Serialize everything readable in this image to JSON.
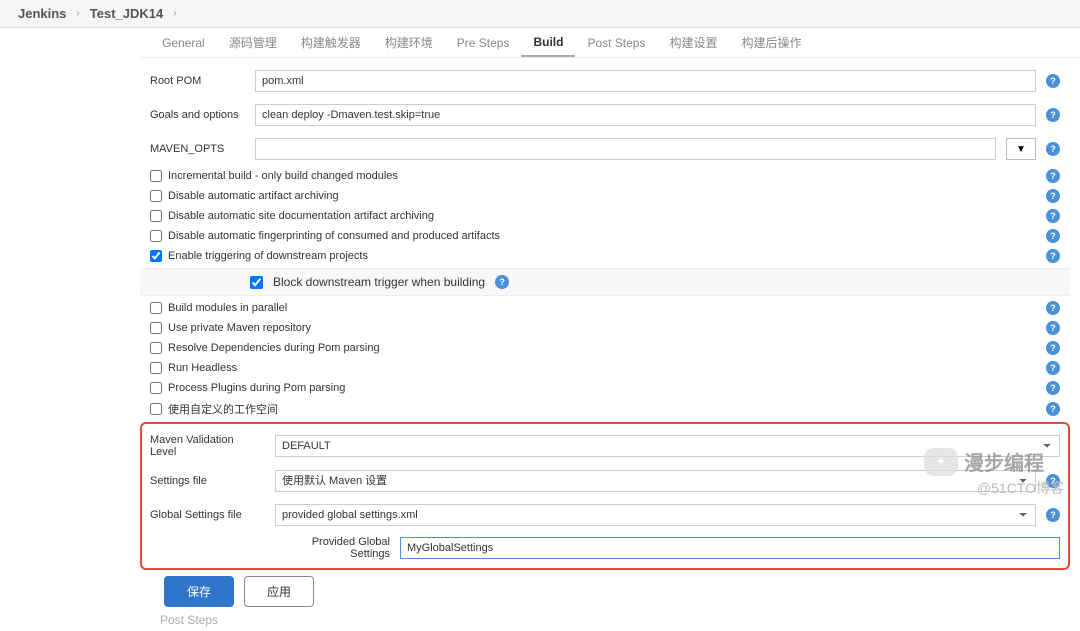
{
  "breadcrumb": {
    "item1": "Jenkins",
    "item2": "Test_JDK14"
  },
  "tabs": {
    "general": "General",
    "src": "源码管理",
    "triggers": "构建触发器",
    "env": "构建环境",
    "pre": "Pre Steps",
    "build": "Build",
    "post": "Post Steps",
    "settings": "构建设置",
    "postactions": "构建后操作"
  },
  "fields": {
    "root_pom_label": "Root POM",
    "root_pom_value": "pom.xml",
    "goals_label": "Goals and options",
    "goals_value": "clean deploy -Dmaven.test.skip=true",
    "maven_opts_label": "MAVEN_OPTS",
    "maven_opts_value": "",
    "dropdown_caret": "▼"
  },
  "checks": {
    "incremental": "Incremental build - only build changed modules",
    "disable_arch": "Disable automatic artifact archiving",
    "disable_site_arch": "Disable automatic site documentation artifact archiving",
    "disable_fp": "Disable automatic fingerprinting of consumed and produced artifacts",
    "enable_trigger": "Enable triggering of downstream projects",
    "block_downstream": "Block downstream trigger when building",
    "build_parallel": "Build modules in parallel",
    "private_repo": "Use private Maven repository",
    "resolve_deps": "Resolve Dependencies during Pom parsing",
    "headless": "Run Headless",
    "process_plugins": "Process Plugins during Pom parsing",
    "custom_workspace": "使用自定义的工作空间"
  },
  "highlight": {
    "maven_validation_label": "Maven Validation Level",
    "maven_validation_value": "DEFAULT",
    "settings_label": "Settings file",
    "settings_value": "使用默认 Maven 设置",
    "global_settings_label": "Global Settings file",
    "global_settings_value": "provided global settings.xml",
    "provided_global_label": "Provided Global Settings",
    "provided_global_value": "MyGlobalSettings"
  },
  "buttons": {
    "save": "保存",
    "apply": "应用"
  },
  "post_steps_stub": "Post Steps",
  "help_glyph": "?",
  "watermark": {
    "logo_text": "漫步编程",
    "site": "@51CTO博客"
  }
}
